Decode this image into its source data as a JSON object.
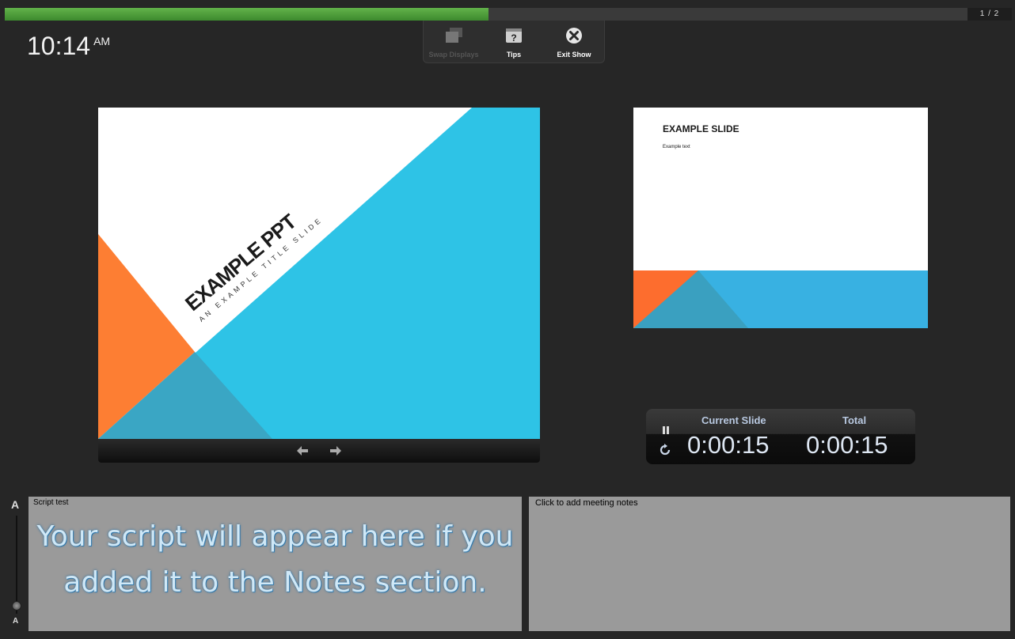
{
  "progress": {
    "fraction": 0.48,
    "counter": "1 / 2"
  },
  "clock": {
    "time": "10:14",
    "ampm": "AM"
  },
  "toolbar": {
    "swap_displays": "Swap Displays",
    "tips": "Tips",
    "exit_show": "Exit Show"
  },
  "current_slide": {
    "title": "EXAMPLE PPT",
    "subtitle": "AN EXAMPLE TITLE SLIDE"
  },
  "next_slide": {
    "title": "EXAMPLE SLIDE",
    "text": "Example text"
  },
  "timer": {
    "current_label": "Current Slide",
    "current_value": "0:00:15",
    "total_label": "Total",
    "total_value": "0:00:15"
  },
  "notes": {
    "title": "Script test",
    "body": "Your script will appear here if you added it to the Notes section."
  },
  "meeting": {
    "placeholder": "Click to add meeting notes"
  },
  "font_slider": {
    "large": "A",
    "small": "A"
  },
  "colors": {
    "orange": "#fd7e33",
    "blue": "#2ec3e6",
    "teal": "#3aa6c4",
    "green": "#4fa33d"
  }
}
